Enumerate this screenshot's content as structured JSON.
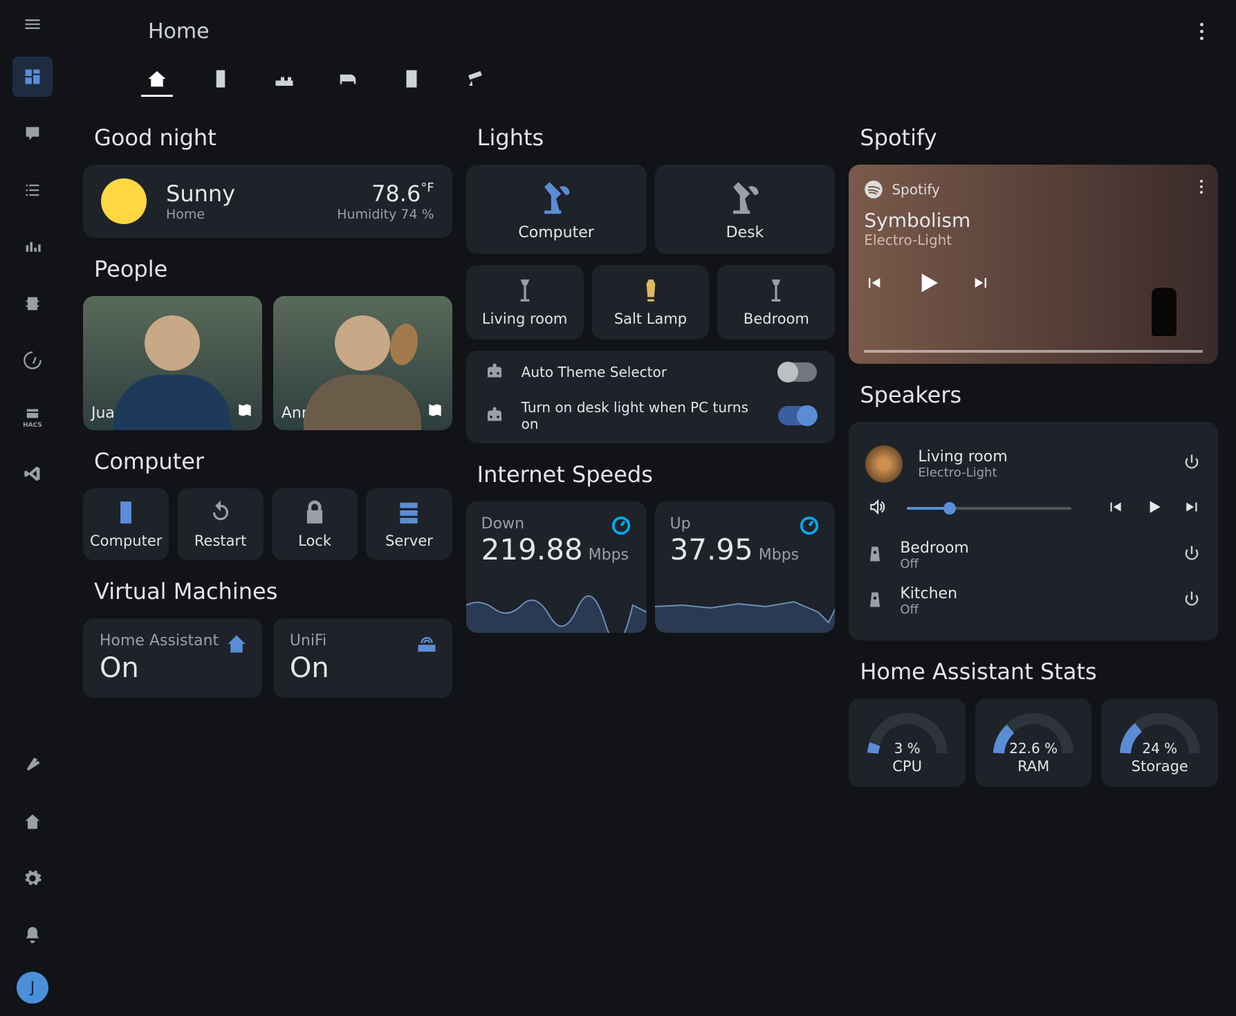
{
  "header": {
    "title": "Home"
  },
  "user_avatar_initial": "J",
  "sections": {
    "greeting": "Good night",
    "people": "People",
    "computer": "Computer",
    "vms": "Virtual Machines",
    "lights": "Lights",
    "speeds": "Internet Speeds",
    "spotify": "Spotify",
    "speakers": "Speakers",
    "stats": "Home Assistant Stats"
  },
  "weather": {
    "condition": "Sunny",
    "location": "Home",
    "temperature": "78.6",
    "temp_unit": "°F",
    "humidity_label": "Humidity 74 %"
  },
  "people": [
    {
      "name": "Juan"
    },
    {
      "name": "Ann"
    }
  ],
  "computer_buttons": [
    {
      "label": "Computer",
      "icon": "desktop-tower-icon",
      "active": true
    },
    {
      "label": "Restart",
      "icon": "restart-icon",
      "active": false
    },
    {
      "label": "Lock",
      "icon": "lock-icon",
      "active": false
    },
    {
      "label": "Server",
      "icon": "server-icon",
      "active": true
    }
  ],
  "vms": [
    {
      "name": "Home Assistant",
      "state": "On",
      "icon": "home-assistant-icon"
    },
    {
      "name": "UniFi",
      "state": "On",
      "icon": "router-icon"
    }
  ],
  "lights_top": [
    {
      "label": "Computer",
      "on": true
    },
    {
      "label": "Desk",
      "on": false
    }
  ],
  "lights_bottom": [
    {
      "label": "Living room",
      "on": false,
      "kind": "floor"
    },
    {
      "label": "Salt Lamp",
      "on": true,
      "kind": "salt"
    },
    {
      "label": "Bedroom",
      "on": false,
      "kind": "floor"
    }
  ],
  "automations": [
    {
      "label": "Auto Theme Selector",
      "on": false
    },
    {
      "label": "Turn on desk light when PC turns on",
      "on": true
    }
  ],
  "speeds": {
    "down": {
      "label": "Down",
      "value": "219.88",
      "unit": "Mbps"
    },
    "up": {
      "label": "Up",
      "value": "37.95",
      "unit": "Mbps"
    }
  },
  "spotify": {
    "app": "Spotify",
    "track": "Symbolism",
    "artist": "Electro-Light"
  },
  "speakers": {
    "playing": {
      "name": "Living room",
      "sub": "Electro-Light"
    },
    "others": [
      {
        "name": "Bedroom",
        "sub": "Off"
      },
      {
        "name": "Kitchen",
        "sub": "Off"
      }
    ]
  },
  "stats": [
    {
      "name": "CPU",
      "pct": "3 %",
      "value": 3
    },
    {
      "name": "RAM",
      "pct": "22.6 %",
      "value": 22.6
    },
    {
      "name": "Storage",
      "pct": "24 %",
      "value": 24
    }
  ],
  "hacs_label": "HACS"
}
